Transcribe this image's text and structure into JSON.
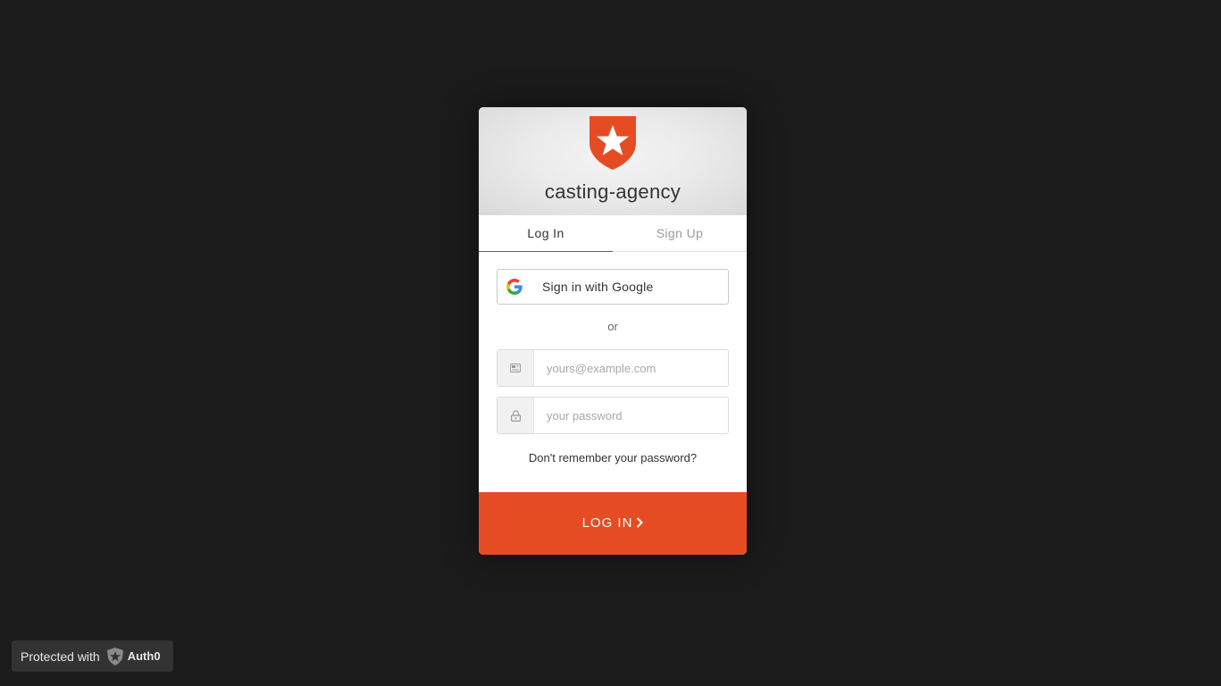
{
  "app": {
    "title": "casting-agency",
    "brand_color": "#e64c24"
  },
  "tabs": [
    {
      "label": "Log In",
      "active": true
    },
    {
      "label": "Sign Up",
      "active": false
    }
  ],
  "social": {
    "google_label": "Sign in with Google",
    "icon": "google-icon"
  },
  "separator": "or",
  "fields": {
    "email": {
      "placeholder": "yours@example.com",
      "value": "",
      "icon": "envelope-icon"
    },
    "password": {
      "placeholder": "your password",
      "value": "",
      "icon": "lock-icon"
    }
  },
  "forgot_label": "Don't remember your password?",
  "submit_label": "LOG IN",
  "badge": {
    "prefix": "Protected with",
    "brand": "Auth0"
  }
}
